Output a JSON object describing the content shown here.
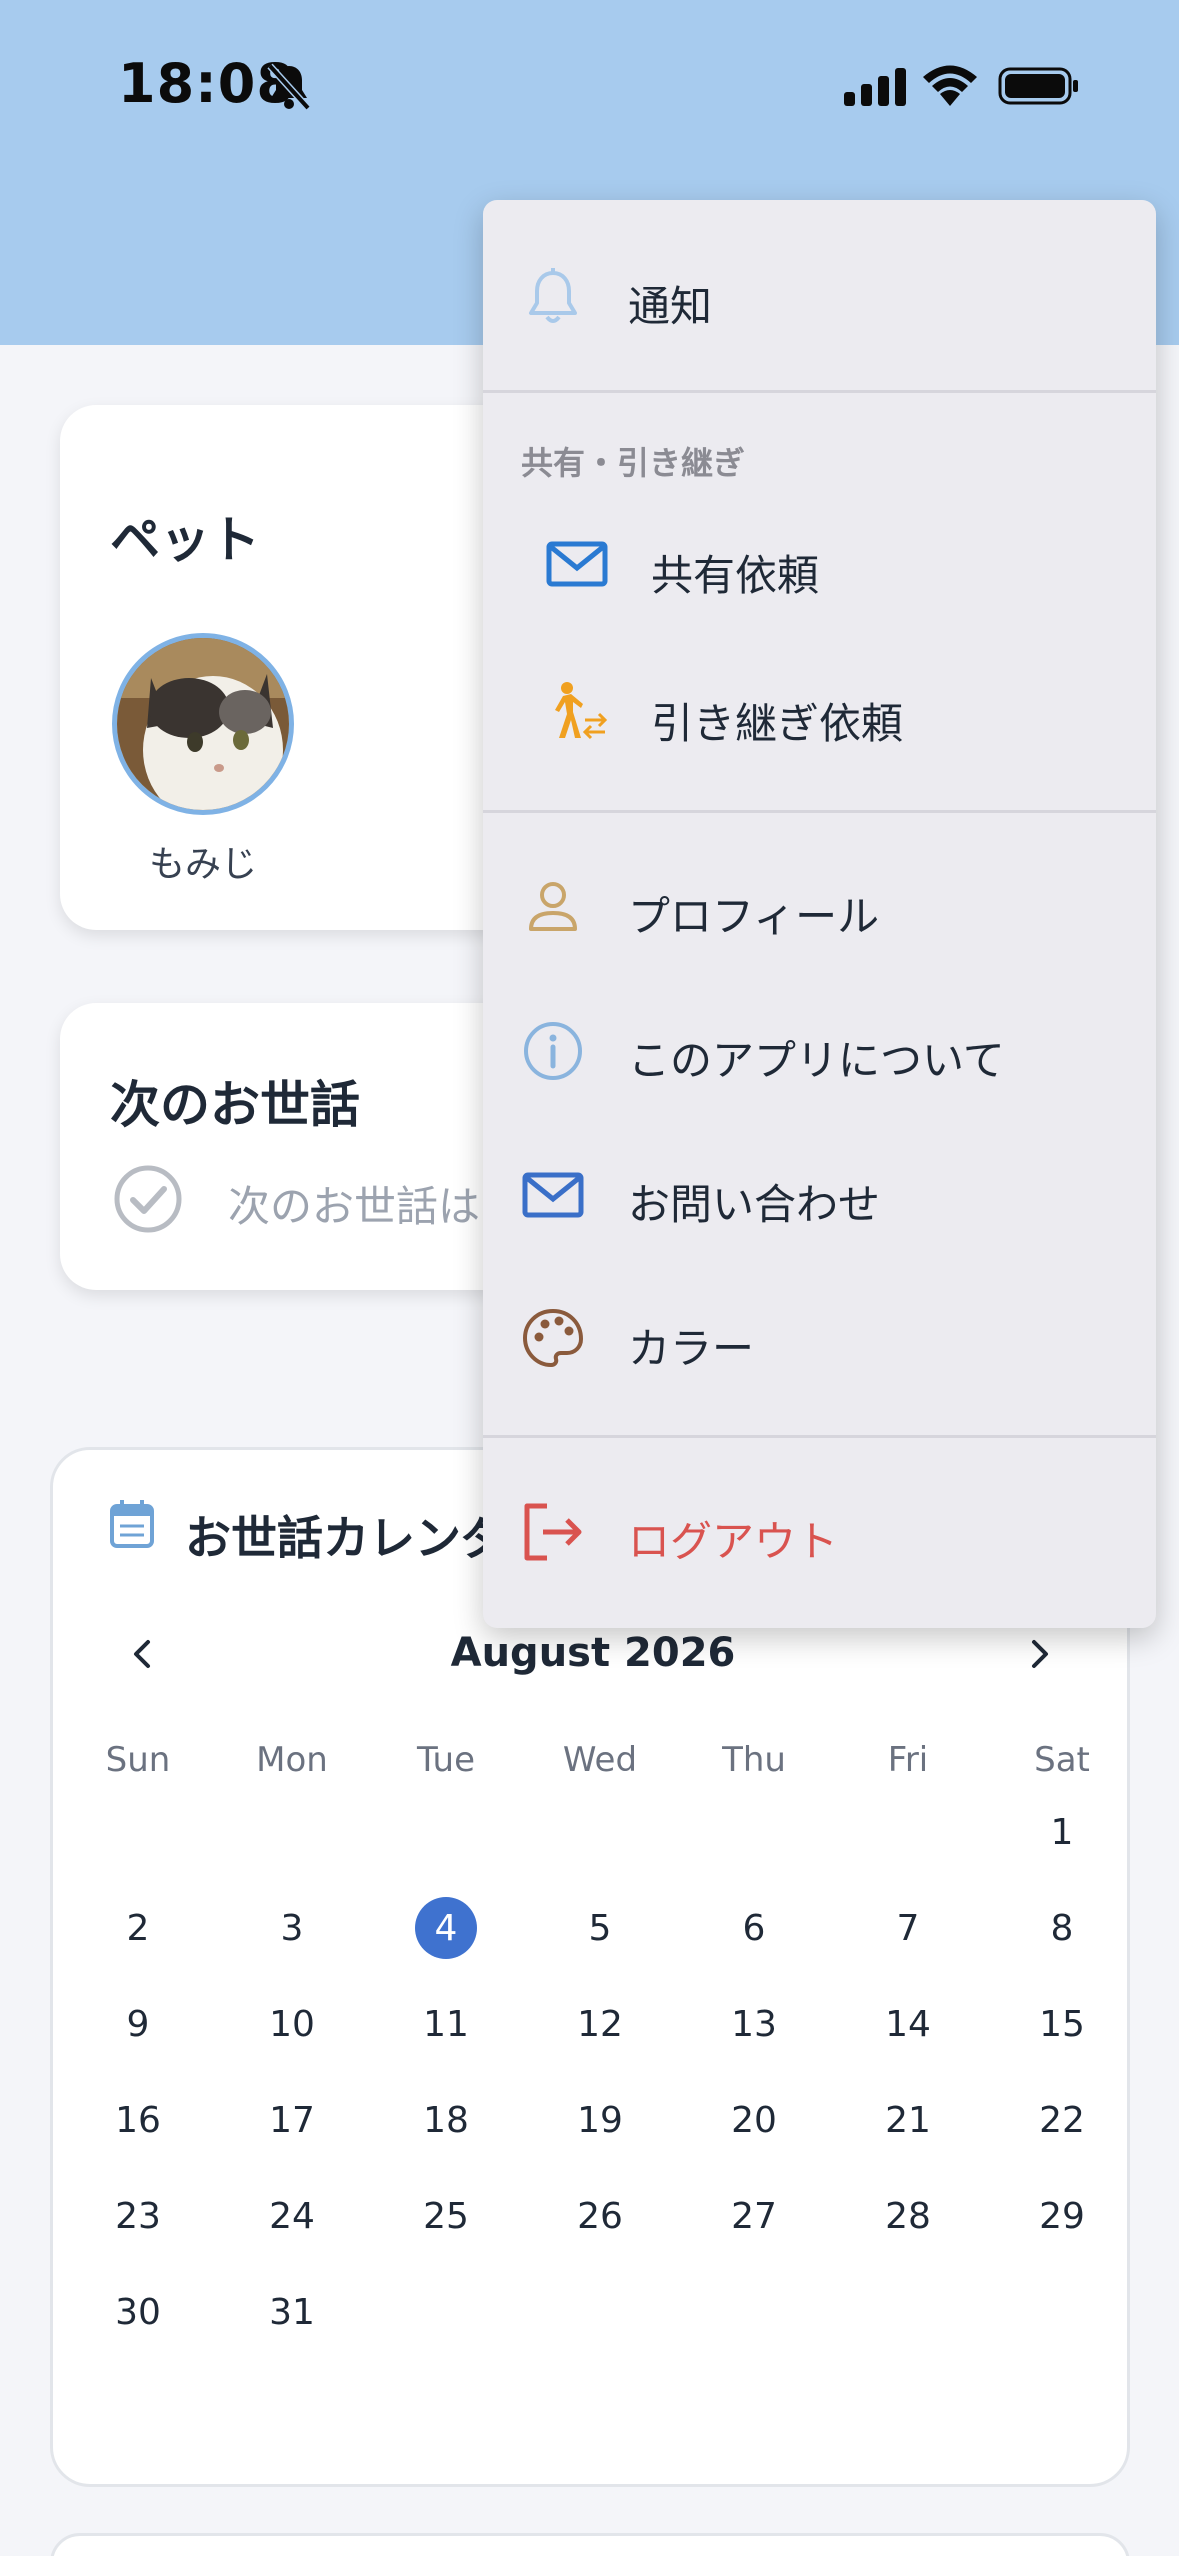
{
  "status_bar": {
    "time": "18:08"
  },
  "pets": {
    "title": "ペット",
    "items": [
      {
        "name": "もみじ"
      }
    ]
  },
  "next_care": {
    "title": "次のお世話",
    "empty_text": "次のお世話は"
  },
  "calendar": {
    "title": "お世話カレンダ",
    "month_label": "August 2026",
    "weekdays": [
      "Sun",
      "Mon",
      "Tue",
      "Wed",
      "Thu",
      "Fri",
      "Sat"
    ],
    "days": [
      "1",
      "2",
      "3",
      "4",
      "5",
      "6",
      "7",
      "8",
      "9",
      "10",
      "11",
      "12",
      "13",
      "14",
      "15",
      "16",
      "17",
      "18",
      "19",
      "20",
      "21",
      "22",
      "23",
      "24",
      "25",
      "26",
      "27",
      "28",
      "29",
      "30",
      "31"
    ],
    "first_weekday_index": 6,
    "today": "4"
  },
  "menu": {
    "notifications_label": "通知",
    "share_section_label": "共有・引き継ぎ",
    "share_request_label": "共有依頼",
    "handover_request_label": "引き継ぎ依頼",
    "profile_label": "プロフィール",
    "about_label": "このアプリについて",
    "contact_label": "お問い合わせ",
    "color_label": "カラー",
    "logout_label": "ログアウト"
  },
  "colors": {
    "header": "#a7cbee",
    "accent": "#3f72cf",
    "logout": "#d9534f",
    "handover_icon": "#f0a020",
    "profile_icon": "#c9a56a",
    "color_icon": "#8a5a3c"
  }
}
